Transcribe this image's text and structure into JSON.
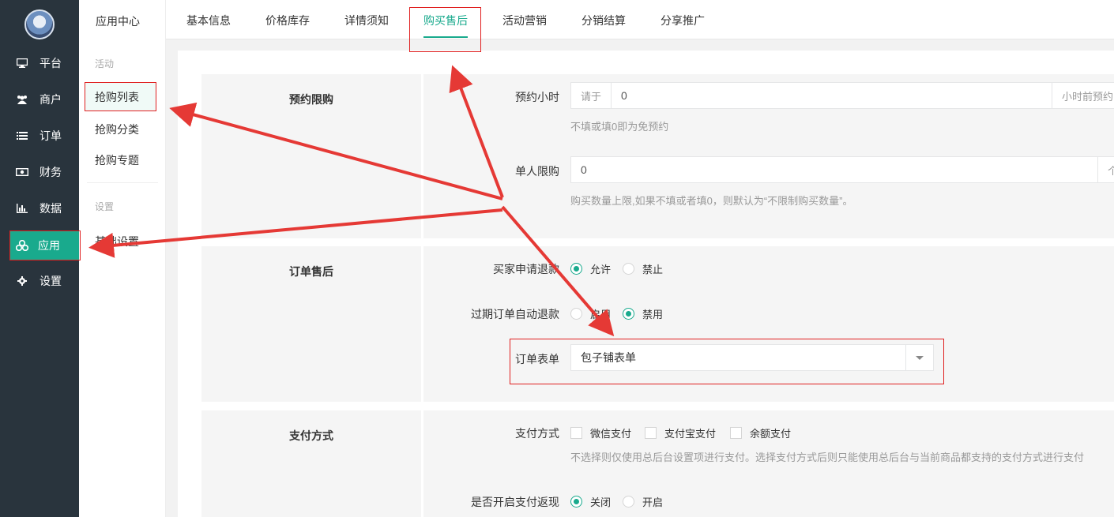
{
  "sidebar": {
    "items": [
      {
        "label": "平台",
        "icon": "monitor-icon"
      },
      {
        "label": "商户",
        "icon": "users-icon"
      },
      {
        "label": "订单",
        "icon": "list-icon"
      },
      {
        "label": "财务",
        "icon": "money-icon"
      },
      {
        "label": "数据",
        "icon": "bar-chart-icon"
      },
      {
        "label": "应用",
        "icon": "cubes-icon"
      },
      {
        "label": "设置",
        "icon": "gear-icon"
      }
    ],
    "active": "应用"
  },
  "submenu": {
    "title": "应用中心",
    "group1": "活动",
    "items1": [
      "抢购列表",
      "抢购分类",
      "抢购专题"
    ],
    "group2": "设置",
    "items2": [
      "基础设置"
    ]
  },
  "tabs": [
    "基本信息",
    "价格库存",
    "详情须知",
    "购买售后",
    "活动营销",
    "分销结算",
    "分享推广"
  ],
  "active_tab": "购买售后",
  "sections": {
    "booking": {
      "label": "预约限购",
      "booking_hours": {
        "label": "预约小时",
        "prefix": "请于",
        "value": "0",
        "suffix": "小时前预约",
        "help": "不填或填0即为免预约"
      },
      "per_person_limit": {
        "label": "单人限购",
        "value": "0",
        "suffix": "个",
        "help": "购买数量上限,如果不填或者填0，则默认为“不限制购买数量”。"
      }
    },
    "after_sale": {
      "label": "订单售后",
      "refund": {
        "label": "买家申请退款",
        "options": [
          "允许",
          "禁止"
        ],
        "selected": "允许"
      },
      "auto_refund": {
        "label": "过期订单自动退款",
        "options": [
          "启用",
          "禁用"
        ],
        "selected": "禁用"
      },
      "order_form": {
        "label": "订单表单",
        "value": "包子铺表单"
      }
    },
    "payment": {
      "label": "支付方式",
      "methods": {
        "label": "支付方式",
        "options": [
          "微信支付",
          "支付宝支付",
          "余额支付"
        ],
        "help": "不选择则仅使用总后台设置项进行支付。选择支付方式后则只能使用总后台与当前商品都支持的支付方式进行支付"
      },
      "cashback": {
        "label": "是否开启支付返现",
        "options": [
          "关闭",
          "开启"
        ],
        "selected": "关闭"
      }
    }
  },
  "colors": {
    "sidebar_bg": "#29343d",
    "accent": "#19aa8d",
    "annotation": "#e02020"
  }
}
